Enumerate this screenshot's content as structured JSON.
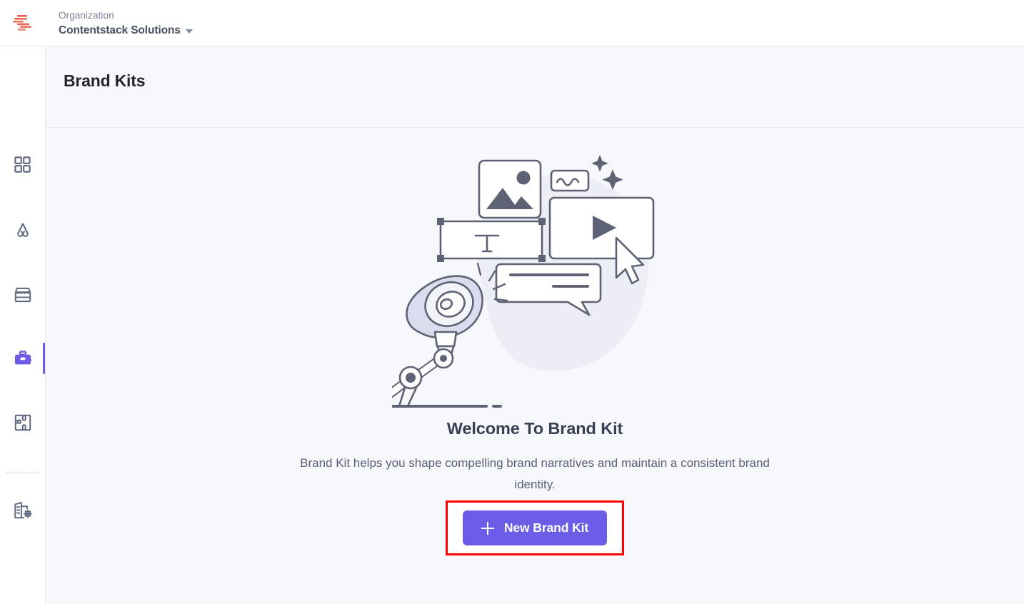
{
  "app": {
    "logo_icon": "contentstack-logo",
    "logo_color": "#e85c4a"
  },
  "topbar": {
    "org_label": "Organization",
    "org_name": "Contentstack Solutions",
    "caret_icon": "chevron-down-icon"
  },
  "sidebar": {
    "active_color": "#6c5ce7",
    "inactive_color": "#5d6880",
    "items": [
      {
        "name": "sidebar-item-dashboard",
        "icon": "grid-dashboard-icon",
        "active": false
      },
      {
        "name": "sidebar-item-automate",
        "icon": "automate-icon",
        "active": false
      },
      {
        "name": "sidebar-item-marketplace",
        "icon": "storefront-icon",
        "active": false
      },
      {
        "name": "sidebar-item-brand-kits",
        "icon": "briefcase-sparkle-icon",
        "active": true
      },
      {
        "name": "sidebar-item-apps",
        "icon": "puzzle-piece-icon",
        "active": false
      },
      {
        "name": "sidebar-item-org-settings",
        "icon": "building-gear-icon",
        "active": false
      }
    ]
  },
  "page": {
    "title": "Brand Kits"
  },
  "empty_state": {
    "illustration_name": "brand-kit-robot-megaphone-illustration",
    "heading": "Welcome To Brand Kit",
    "description": "Brand Kit helps you shape compelling brand narratives and maintain a consistent brand identity.",
    "cta_label": "New Brand Kit",
    "cta_icon": "plus-icon",
    "cta_color": "#6c5ce7",
    "highlight_color": "#ff0000"
  }
}
